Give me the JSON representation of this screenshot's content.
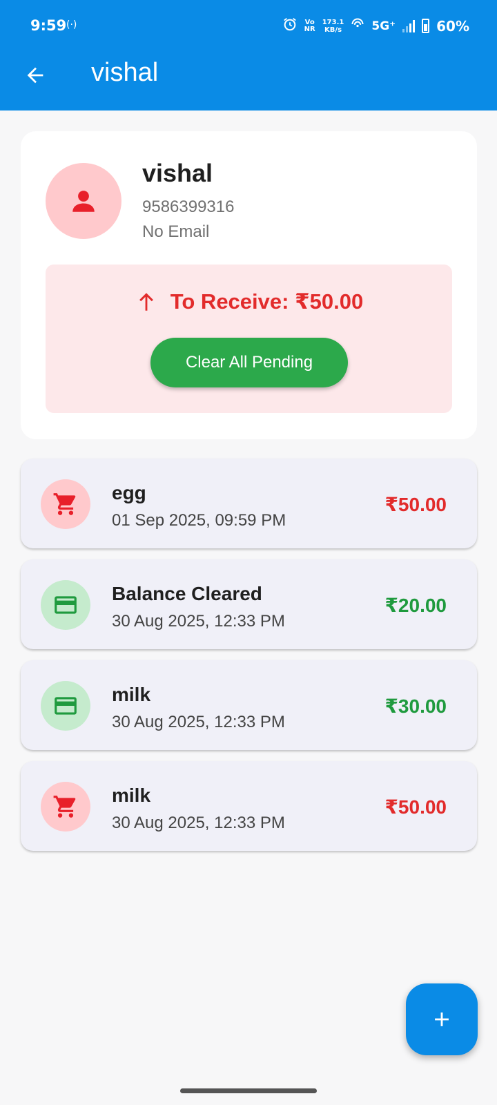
{
  "status_bar": {
    "time": "9:59",
    "hotspot_icon": "hotspot-icon",
    "alarm_icon": "alarm-icon",
    "volte_line1": "Vo",
    "volte_line2": "NR",
    "speed_value": "173.1",
    "speed_unit": "KB/s",
    "network": "5G⁺",
    "battery": "60%"
  },
  "app_bar": {
    "back_icon": "arrow-back-icon",
    "title": "vishal",
    "color": "#0a8be6"
  },
  "profile": {
    "avatar_icon": "person-icon",
    "name": "vishal",
    "phone": "9586399316",
    "email": "No Email"
  },
  "balance": {
    "icon": "arrow-up-icon",
    "text": "To Receive: ₹50.00",
    "clear_button": "Clear All Pending",
    "color": "#e22b2b"
  },
  "transactions": [
    {
      "icon": "cart-icon",
      "title": "egg",
      "date": "01 Sep 2025, 09:59 PM",
      "amount": "₹50.00",
      "type": "debit"
    },
    {
      "icon": "card-icon",
      "title": "Balance Cleared",
      "date": "30 Aug 2025, 12:33 PM",
      "amount": "₹20.00",
      "type": "credit"
    },
    {
      "icon": "card-icon",
      "title": "milk",
      "date": "30 Aug 2025, 12:33 PM",
      "amount": "₹30.00",
      "type": "credit"
    },
    {
      "icon": "cart-icon",
      "title": "milk",
      "date": "30 Aug 2025, 12:33 PM",
      "amount": "₹50.00",
      "type": "debit"
    }
  ],
  "fab": {
    "icon": "add-icon"
  },
  "colors": {
    "debit": "#e22b2b",
    "credit": "#1f9a3e",
    "primary": "#0a8be6"
  }
}
